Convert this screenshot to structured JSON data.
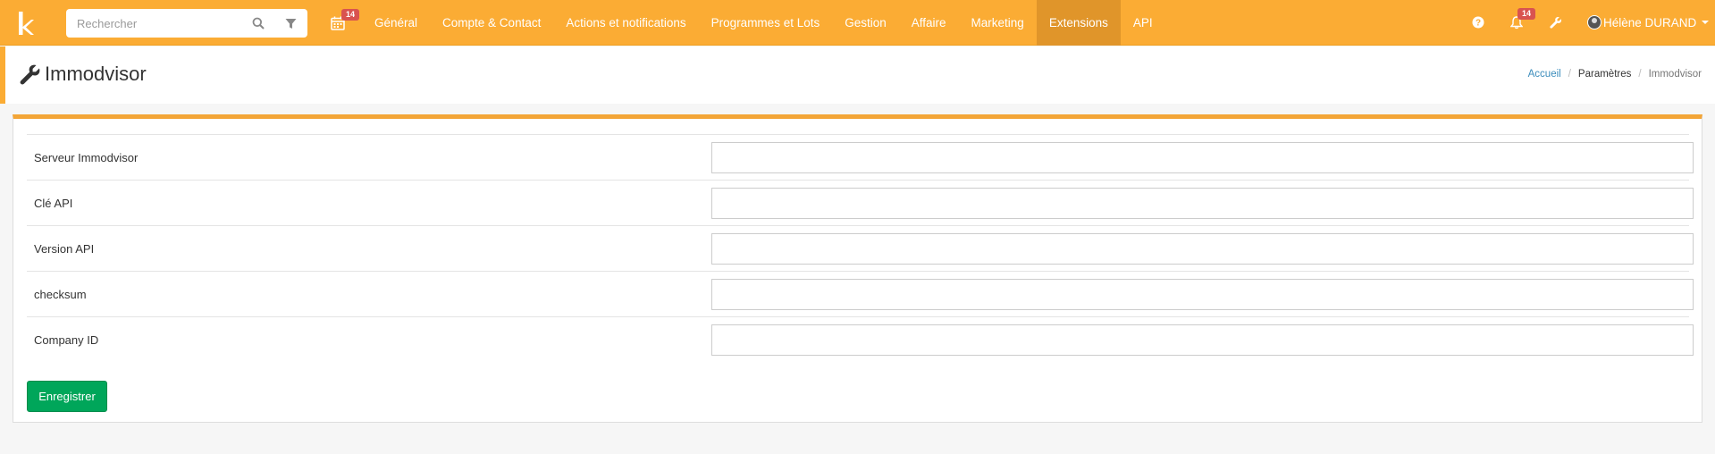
{
  "navbar": {
    "logo_letter": "k",
    "search": {
      "placeholder": "Rechercher",
      "value": ""
    },
    "calendar_badge": "14",
    "menu": [
      {
        "label": "Général"
      },
      {
        "label": "Compte & Contact"
      },
      {
        "label": "Actions et notifications"
      },
      {
        "label": "Programmes et Lots"
      },
      {
        "label": "Gestion"
      },
      {
        "label": "Affaire"
      },
      {
        "label": "Marketing"
      },
      {
        "label": "Extensions",
        "active": true
      },
      {
        "label": "API"
      }
    ],
    "notification_badge": "14",
    "user_name": "Hélène DURAND"
  },
  "page": {
    "title": "Immodvisor",
    "breadcrumb": {
      "home": "Accueil",
      "settings": "Paramètres",
      "current": "Immodvisor"
    }
  },
  "form": {
    "fields": [
      {
        "label": "Serveur Immodvisor",
        "value": ""
      },
      {
        "label": "Clé API",
        "value": ""
      },
      {
        "label": "Version API",
        "value": ""
      },
      {
        "label": "checksum",
        "value": ""
      },
      {
        "label": "Company ID",
        "value": ""
      }
    ],
    "save_label": "Enregistrer"
  },
  "colors": {
    "brand": "#fbac34",
    "active_nav": "#e0952a",
    "save": "#00a65a",
    "badge": "#d9534f",
    "link": "#3c8dbc"
  }
}
